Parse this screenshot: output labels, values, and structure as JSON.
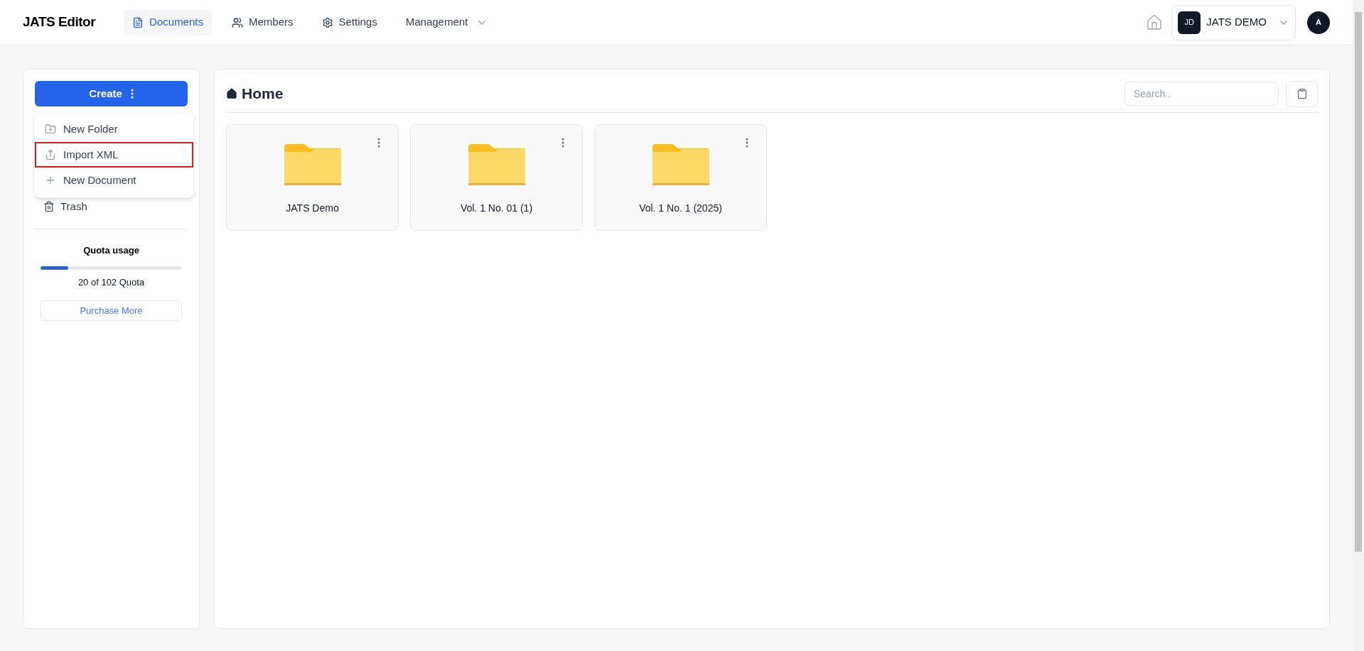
{
  "app": {
    "title": "JATS Editor"
  },
  "nav": [
    {
      "label": "Documents",
      "selected": true,
      "kind": "document"
    },
    {
      "label": "Members",
      "selected": false,
      "kind": "members"
    },
    {
      "label": "Settings",
      "selected": false,
      "kind": "settings"
    },
    {
      "label": "Management",
      "selected": false,
      "kind": "dropdown"
    }
  ],
  "workspace": {
    "initials": "JD",
    "name": "JATS DEMO"
  },
  "avatar": {
    "initial": "A"
  },
  "sidebar": {
    "create_button": "Create",
    "create_menu": [
      {
        "label": "New Folder",
        "kind": "folder",
        "highlighted": false
      },
      {
        "label": "Import XML",
        "kind": "upload",
        "highlighted": true
      },
      {
        "label": "New Document",
        "kind": "plus",
        "highlighted": false
      }
    ],
    "items": [
      {
        "label": "Trash",
        "kind": "trash"
      }
    ],
    "quota": {
      "title": "Quota usage",
      "level": 0.196,
      "reading": "20 of 102 Quota",
      "button": "Purchase More"
    }
  },
  "main": {
    "title": "Home",
    "search": {
      "placeholder": "Search.."
    },
    "folders": [
      {
        "name": "JATS Demo"
      },
      {
        "name": "Vol. 1 No. 01 (1)"
      },
      {
        "name": "Vol. 1 No. 1 (2025)"
      }
    ]
  }
}
